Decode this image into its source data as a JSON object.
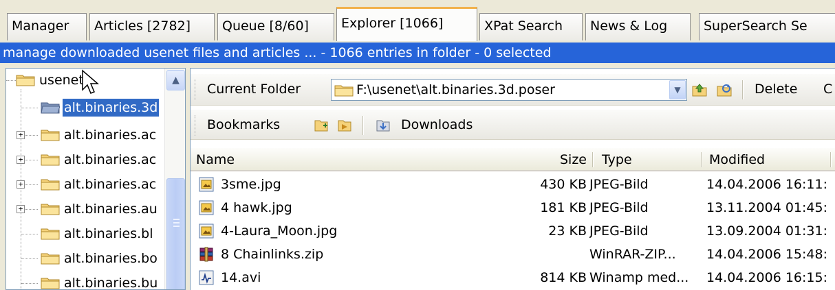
{
  "tabs": [
    {
      "label": "Manager",
      "active": false
    },
    {
      "label": "Articles [2782]",
      "active": false
    },
    {
      "label": "Queue [8/60]",
      "active": false
    },
    {
      "label": "Explorer [1066]",
      "active": true
    },
    {
      "label": "XPat Search",
      "active": false
    },
    {
      "label": "News & Log",
      "active": false
    },
    {
      "label": "SuperSearch Se",
      "active": false
    }
  ],
  "status_bar": {
    "text": "manage downloaded usenet files and articles ...  -  1066 entries in folder  -  0 selected"
  },
  "tree": {
    "root_label": "usenet",
    "items": [
      {
        "label": "alt.binaries.3d",
        "selected": true,
        "expandable": false
      },
      {
        "label": "alt.binaries.ac",
        "selected": false,
        "expandable": true
      },
      {
        "label": "alt.binaries.ac",
        "selected": false,
        "expandable": true
      },
      {
        "label": "alt.binaries.ac",
        "selected": false,
        "expandable": true
      },
      {
        "label": "alt.binaries.au",
        "selected": false,
        "expandable": true
      },
      {
        "label": "alt.binaries.bl",
        "selected": false,
        "expandable": false
      },
      {
        "label": "alt.binaries.bo",
        "selected": false,
        "expandable": false
      },
      {
        "label": "alt.binaries.bu",
        "selected": false,
        "expandable": false
      }
    ]
  },
  "folder_toolbar": {
    "label": "Current Folder",
    "path": "F:\\usenet\\alt.binaries.3d.poser",
    "delete_label": "Delete",
    "cut_label": "C"
  },
  "bookmarks_toolbar": {
    "label": "Bookmarks",
    "downloads_label": "Downloads"
  },
  "file_list": {
    "columns": [
      "Name",
      "Size",
      "Type",
      "Modified"
    ],
    "rows": [
      {
        "name": "3sme.jpg",
        "size": "430 KB",
        "type": "JPEG-Bild",
        "modified": "14.04.2006 16:11:",
        "icon": "jpeg-file-icon"
      },
      {
        "name": "4 hawk.jpg",
        "size": "181 KB",
        "type": "JPEG-Bild",
        "modified": "13.11.2004 01:45:",
        "icon": "jpeg-file-icon"
      },
      {
        "name": "4-Laura_Moon.jpg",
        "size": "23 KB",
        "type": "JPEG-Bild",
        "modified": "13.09.2004 01:31:",
        "icon": "jpeg-file-icon"
      },
      {
        "name": "8 Chainlinks.zip",
        "size": "",
        "type": "WinRAR-ZIP...",
        "modified": "14.04.2006 15:48:",
        "icon": "winrar-archive-icon"
      },
      {
        "name": "14.avi",
        "size": "814 KB",
        "type": "Winamp med...",
        "modified": "14.04.2006 16:15:",
        "icon": "winamp-media-icon"
      }
    ]
  },
  "colors": {
    "status_bar_bg": "#2664D9",
    "selection_bg": "#316AC5",
    "active_tab_accent": "#F2B24D",
    "window_bg": "#ECE9D8"
  }
}
